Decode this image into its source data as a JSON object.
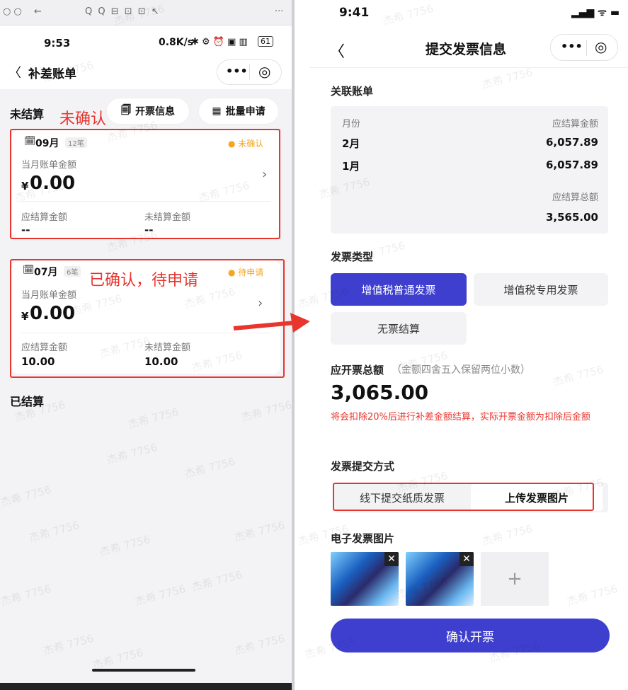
{
  "left": {
    "browser_bar": {
      "dots": "○ ○",
      "back": "←",
      "icons": "Q  Q  ⊟      ⊡  ⊡  ↖",
      "more": "···"
    },
    "status": {
      "time": "9:53",
      "net": "0.8K/s",
      "icons": "✱ ⚙ ⏰ ▣ ▥",
      "battery": "61"
    },
    "nav": {
      "back": "〈",
      "title": "补差账单",
      "more": "•••",
      "target": "◎"
    },
    "section_unsettled": "未结算",
    "annot_unconfirmed": "未确认",
    "btn_invoice_info": "开票信息",
    "btn_batch_apply": "批量申请",
    "card1": {
      "month": "09月",
      "count": "12笔",
      "status": "● 未确认",
      "amount_label": "当月账单金额",
      "amount": "0.00",
      "currency": "¥",
      "due_label": "应结算金额",
      "due": "--",
      "unsettled_label": "未结算金额",
      "unsettled": "--"
    },
    "annot_confirmed": "已确认，待申请",
    "card2": {
      "month": "07月",
      "count": "6笔",
      "status": "● 待申请",
      "amount_label": "当月账单金额",
      "amount": "0.00",
      "currency": "¥",
      "due_label": "应结算金额",
      "due": "10.00",
      "unsettled_label": "未结算金额",
      "unsettled": "10.00"
    },
    "section_settled": "已结算"
  },
  "right": {
    "status": {
      "time": "9:41",
      "icons": "▂▄▆ ᯤ ▬"
    },
    "nav": {
      "back": "〈",
      "title": "提交发票信息",
      "more": "•••",
      "target": "◎"
    },
    "linked_bills": "关联账单",
    "table": {
      "col_month": "月份",
      "col_due": "应结算金额",
      "rows": [
        {
          "month": "2月",
          "amount": "6,057.89"
        },
        {
          "month": "1月",
          "amount": "6,057.89"
        }
      ],
      "total_label": "应结算总额",
      "total": "3,565.00"
    },
    "invoice_type": "发票类型",
    "types": [
      "增值税普通发票",
      "增值税专用发票",
      "无票结算"
    ],
    "total_invoice_label": "应开票总额",
    "total_invoice_hint": "（金额四舍五入保留两位小数）",
    "total_invoice": "3,065.00",
    "warning": "将会扣除20%后进行补差金额结算，实际开票金额为扣除后金额",
    "submit_method": "发票提交方式",
    "methods": [
      "线下提交纸质发票",
      "上传发票图片"
    ],
    "e_invoice": "电子发票图片",
    "add": "+",
    "close": "✕",
    "confirm": "确认开票"
  },
  "watermark": "杰希 7756",
  "colors": {
    "accent": "#3f3fcf",
    "annotation": "#e8352e",
    "pending": "#f5a623"
  }
}
